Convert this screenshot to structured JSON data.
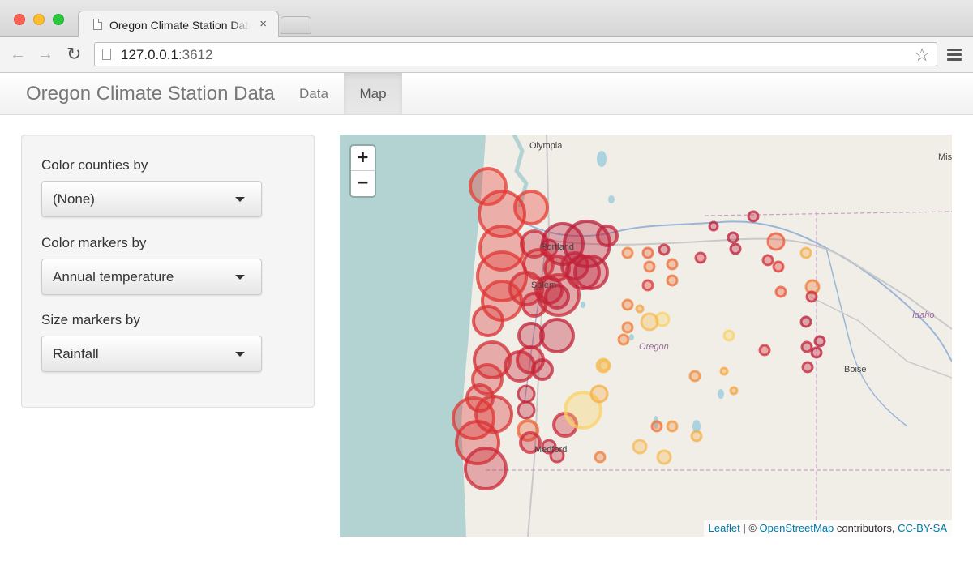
{
  "browser": {
    "tab_title": "Oregon Climate Station Data",
    "tab_close": "×",
    "url_host": "127.0.0.1",
    "url_port": ":3612",
    "back_glyph": "←",
    "forward_glyph": "→",
    "reload_glyph": "↻",
    "star_glyph": "☆"
  },
  "navbar": {
    "brand": "Oregon Climate Station Data",
    "tabs": [
      {
        "label": "Data",
        "active": false
      },
      {
        "label": "Map",
        "active": true
      }
    ]
  },
  "sidebar": {
    "controls": [
      {
        "label": "Color counties by",
        "selected": "(None)"
      },
      {
        "label": "Color markers by",
        "selected": "Annual temperature"
      },
      {
        "label": "Size markers by",
        "selected": "Rainfall"
      }
    ]
  },
  "map": {
    "zoom_in": "+",
    "zoom_out": "−",
    "labels": {
      "olympia": "Olympia",
      "portland": "Portland",
      "salem": "Salem",
      "oregon": "Oregon",
      "idaho": "Idaho",
      "boise": "Boise",
      "medford": "Medford",
      "mis": "Mis"
    },
    "attribution": {
      "leaflet": "Leaflet",
      "copyright": " | © ",
      "osm": "OpenStreetMap",
      "contributors": " contributors, ",
      "license": "CC-BY-SA"
    },
    "colors": {
      "ocean": "#b3d3d2",
      "land": "#f1eee8",
      "marker_cold": "#b2183a",
      "marker_warm": "#f4a33c"
    }
  }
}
